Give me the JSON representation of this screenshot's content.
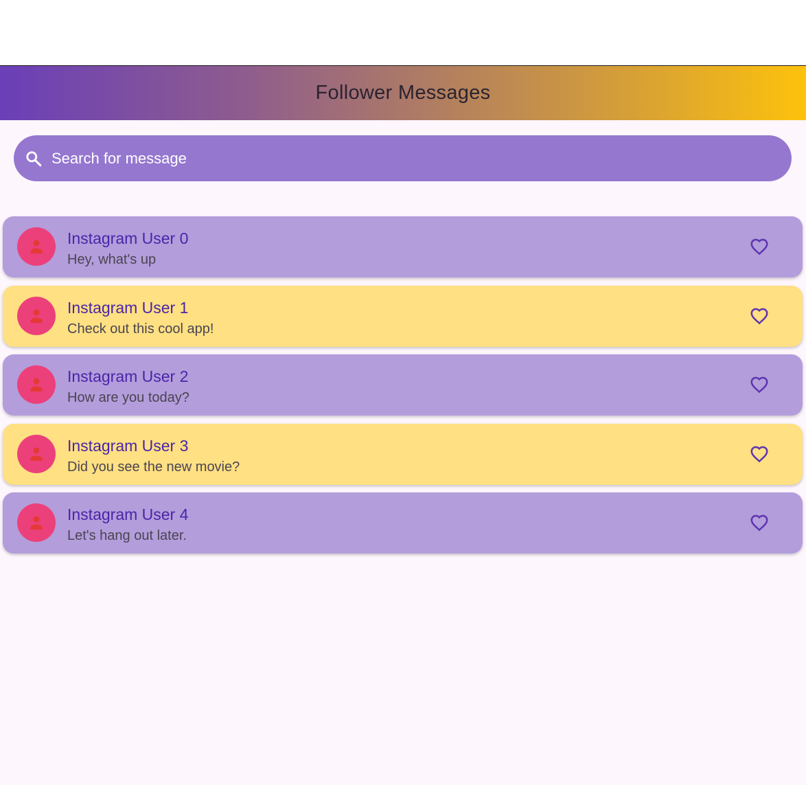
{
  "app_bar": {
    "title": "Follower Messages",
    "gradient_start": "#6a3fb8",
    "gradient_end": "#fdc20c"
  },
  "search": {
    "placeholder": "Search for message",
    "value": "",
    "icon": "search-icon",
    "background": "#9577cf"
  },
  "messages": [
    {
      "name": "Instagram User 0",
      "text": "Hey, what's up",
      "background": "#b39ddb",
      "avatar_icon": "person-icon",
      "action_icon": "heart-outline-icon"
    },
    {
      "name": "Instagram User 1",
      "text": "Check out this cool app!",
      "background": "#ffe082",
      "avatar_icon": "person-icon",
      "action_icon": "heart-outline-icon"
    },
    {
      "name": "Instagram User 2",
      "text": "How are you today?",
      "background": "#b39ddb",
      "avatar_icon": "person-icon",
      "action_icon": "heart-outline-icon"
    },
    {
      "name": "Instagram User 3",
      "text": "Did you see the new movie?",
      "background": "#ffe082",
      "avatar_icon": "person-icon",
      "action_icon": "heart-outline-icon"
    },
    {
      "name": "Instagram User 4",
      "text": "Let's hang out later.",
      "background": "#b39ddb",
      "avatar_icon": "person-icon",
      "action_icon": "heart-outline-icon"
    }
  ],
  "colors": {
    "avatar": "#ec407a",
    "avatar_person": "#e53935",
    "name_text": "#4a25a8",
    "heart": "#5e35b1"
  }
}
